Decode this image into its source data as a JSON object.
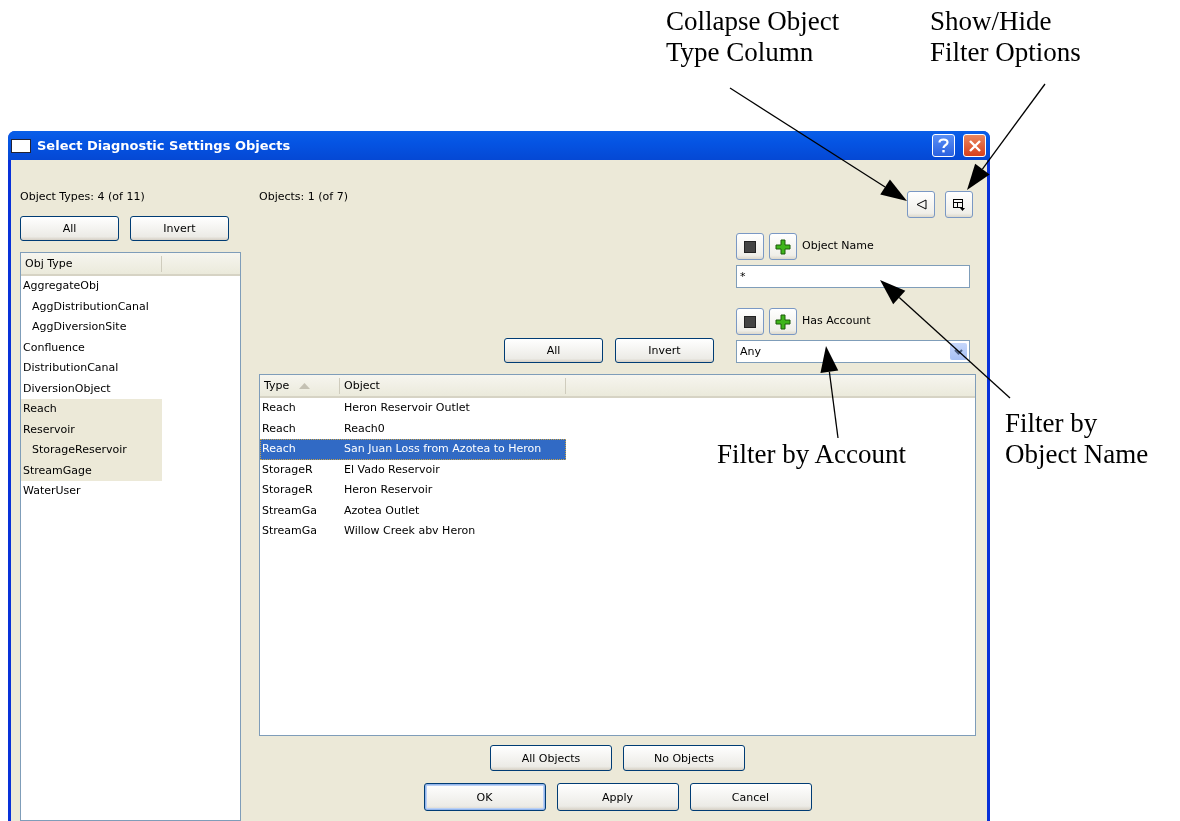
{
  "annotations": [
    {
      "kind": "collapse",
      "text": "Collapse Object Type Column"
    },
    {
      "kind": "filters",
      "text": "Show/Hide Filter Options"
    },
    {
      "kind": "account",
      "text": "Filter by Account"
    },
    {
      "kind": "name",
      "text": "Filter by Object Name"
    }
  ],
  "window": {
    "title": "Select Diagnostic Settings Objects"
  },
  "object_types": {
    "label": "Object Types: 4 (of 11)",
    "buttons": [
      "All",
      "Invert"
    ],
    "column": "Obj Type",
    "items": [
      {
        "label": "AggregateObj",
        "selected": false,
        "children": [
          {
            "label": "AggDistributionCanal",
            "selected": false
          },
          {
            "label": "AggDiversionSite",
            "selected": false
          }
        ]
      },
      {
        "label": "Confluence",
        "selected": false
      },
      {
        "label": "DistributionCanal",
        "selected": false
      },
      {
        "label": "DiversionObject",
        "selected": false
      },
      {
        "label": "Reach",
        "selected": true
      },
      {
        "label": "Reservoir",
        "selected": true,
        "children": [
          {
            "label": "StorageReservoir",
            "selected": true
          }
        ]
      },
      {
        "label": "StreamGage",
        "selected": true
      },
      {
        "label": "WaterUser",
        "selected": false
      }
    ]
  },
  "objects": {
    "label": "Objects: 1 (of 7)",
    "buttons": [
      "All",
      "Invert"
    ],
    "filters": [
      {
        "kind": "text",
        "label": "Object Name",
        "value": "*"
      },
      {
        "kind": "select",
        "label": "Has Account",
        "value": "Any"
      }
    ],
    "columns": [
      {
        "label": "Type",
        "sorted": true
      },
      {
        "label": "Object",
        "sorted": false
      }
    ],
    "rows": [
      {
        "cells": [
          "Reach",
          "Heron Reservoir Outlet"
        ],
        "selected": false
      },
      {
        "cells": [
          "Reach",
          "Reach0"
        ],
        "selected": false
      },
      {
        "cells": [
          "Reach",
          "San Juan Loss from Azotea to Heron"
        ],
        "selected": true
      },
      {
        "cells": [
          "StorageR",
          "El Vado Reservoir"
        ],
        "selected": false
      },
      {
        "cells": [
          "StorageR",
          "Heron Reservoir"
        ],
        "selected": false
      },
      {
        "cells": [
          "StreamGa",
          "Azotea Outlet"
        ],
        "selected": false
      },
      {
        "cells": [
          "StreamGa",
          "Willow Creek abv Heron"
        ],
        "selected": false
      }
    ],
    "object_buttons": [
      "All Objects",
      "No Objects"
    ]
  },
  "buttons": [
    {
      "label": "OK",
      "default": true
    },
    {
      "label": "Apply",
      "default": false
    },
    {
      "label": "Cancel",
      "default": false
    }
  ]
}
